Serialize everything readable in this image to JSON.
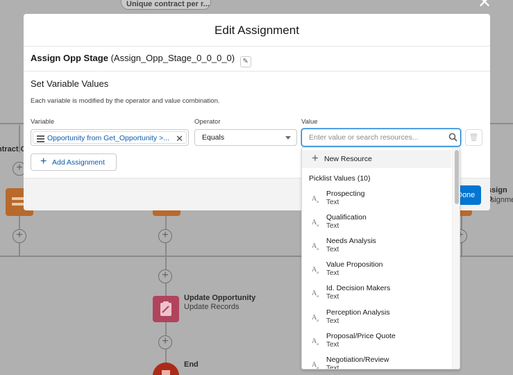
{
  "canvas": {
    "top_pill": "Unique contract per r...",
    "left_cut_text": "ntract C",
    "update_node": {
      "title": "Update Opportunity",
      "subtitle": "Update Records"
    },
    "end_node": {
      "title": "End"
    },
    "right_node": {
      "title": "Assign Op",
      "subtitle": "Assignmen"
    }
  },
  "modal": {
    "title": "Edit Assignment",
    "element_name": "Assign Opp Stage",
    "api_name": "(Assign_Opp_Stage_0_0_0_0)",
    "section_title": "Set Variable Values",
    "section_desc": "Each variable is modified by the operator and value combination.",
    "labels": {
      "variable": "Variable",
      "operator": "Operator",
      "value": "Value"
    },
    "variable_value": "Opportunity from Get_Opportunity >...",
    "operator_value": "Equals",
    "value_placeholder": "Enter value or search resources...",
    "add_assignment": "Add Assignment",
    "done_label": "Done"
  },
  "dropdown": {
    "new_resource": "New Resource",
    "heading": "Picklist Values (10)",
    "items": [
      {
        "label": "Prospecting",
        "type": "Text"
      },
      {
        "label": "Qualification",
        "type": "Text"
      },
      {
        "label": "Needs Analysis",
        "type": "Text"
      },
      {
        "label": "Value Proposition",
        "type": "Text"
      },
      {
        "label": "Id. Decision Makers",
        "type": "Text"
      },
      {
        "label": "Perception Analysis",
        "type": "Text"
      },
      {
        "label": "Proposal/Price Quote",
        "type": "Text"
      },
      {
        "label": "Negotiation/Review",
        "type": "Text"
      }
    ]
  },
  "colors": {
    "brand_blue": "#0176d3",
    "link_blue": "#0b5cab",
    "assignment_orange": "#b8692c",
    "update_pink": "#b0445d",
    "end_red": "#ab2b18"
  },
  "icons": [
    "close-icon",
    "pencil-icon",
    "list-icon",
    "clear-icon",
    "chevron-down-icon",
    "search-icon",
    "trash-icon",
    "plus-icon",
    "text-type-icon"
  ]
}
